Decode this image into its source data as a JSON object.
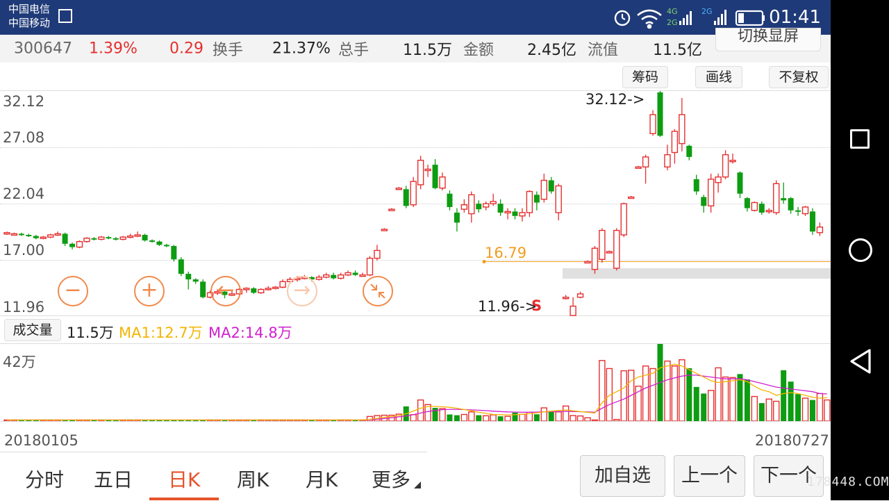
{
  "status_bar": {
    "carrier_1": "中国电信",
    "carrier_2": "中国移动",
    "network_1": "4G",
    "network_2": "2G",
    "network_3": "2G",
    "time": "01:41"
  },
  "quote": {
    "code": "300647",
    "change_pct": "1.39%",
    "change": "0.29",
    "turnover_label": "换手",
    "turnover": "21.37%",
    "total_hands_label": "总手",
    "total_hands": "11.5万",
    "amount_label": "金额",
    "amount": "2.45亿",
    "float_label": "流值",
    "float_value": "11.5亿",
    "switch_button": "切换显屏"
  },
  "toolbar": {
    "chips_label": "筹码",
    "draw_label": "画线",
    "adjust_label": "不复权"
  },
  "chart_data": [
    {
      "type": "candlestick",
      "y_ticks": [
        "32.12",
        "27.08",
        "22.04",
        "17.00",
        "11.96"
      ],
      "ylim": [
        11.96,
        32.12
      ],
      "high_annotation": "32.12->",
      "low_annotation": "11.96->",
      "reference_line": {
        "label": "16.79",
        "value": 16.79
      },
      "low_marker": "S",
      "candles": [
        [
          19.3,
          19.4,
          19.5,
          19.2
        ],
        [
          19.3,
          19.3,
          19.4,
          19.2
        ],
        [
          19.3,
          19.2,
          19.4,
          19.1
        ],
        [
          19.2,
          19.1,
          19.3,
          19.0
        ],
        [
          19.1,
          18.9,
          19.2,
          18.8
        ],
        [
          18.9,
          19.0,
          19.1,
          18.8
        ],
        [
          19.0,
          19.2,
          19.3,
          18.9
        ],
        [
          19.2,
          19.3,
          19.5,
          19.1
        ],
        [
          19.3,
          18.4,
          19.4,
          18.2
        ],
        [
          18.4,
          18.1,
          18.5,
          17.9
        ],
        [
          18.1,
          18.6,
          18.7,
          18.0
        ],
        [
          18.6,
          18.9,
          19.0,
          18.5
        ],
        [
          18.9,
          18.8,
          19.0,
          18.7
        ],
        [
          18.8,
          19.0,
          19.1,
          18.7
        ],
        [
          19.0,
          18.9,
          19.1,
          18.8
        ],
        [
          18.9,
          18.8,
          19.0,
          18.7
        ],
        [
          18.8,
          19.0,
          19.1,
          18.7
        ],
        [
          19.0,
          19.1,
          19.3,
          18.9
        ],
        [
          19.1,
          19.2,
          19.5,
          19.0
        ],
        [
          19.2,
          18.7,
          19.3,
          18.6
        ],
        [
          18.7,
          18.6,
          18.8,
          18.5
        ],
        [
          18.6,
          18.3,
          18.7,
          18.2
        ],
        [
          18.3,
          18.2,
          18.4,
          18.1
        ],
        [
          18.2,
          17.0,
          18.3,
          16.8
        ],
        [
          17.0,
          15.7,
          17.2,
          15.5
        ],
        [
          15.7,
          15.2,
          15.9,
          14.3
        ],
        [
          15.2,
          15.0,
          15.3,
          14.8
        ],
        [
          15.0,
          13.6,
          15.2,
          13.5
        ],
        [
          13.6,
          14.0,
          14.2,
          13.5
        ],
        [
          14.0,
          14.1,
          14.3,
          13.8
        ],
        [
          14.1,
          13.8,
          14.2,
          13.5
        ],
        [
          13.8,
          13.9,
          14.2,
          13.7
        ],
        [
          13.9,
          14.3,
          14.4,
          13.8
        ],
        [
          14.3,
          14.4,
          14.5,
          14.0
        ],
        [
          14.4,
          14.0,
          14.5,
          13.9
        ],
        [
          14.0,
          14.3,
          14.4,
          13.9
        ],
        [
          14.3,
          14.4,
          14.6,
          14.2
        ],
        [
          14.4,
          14.5,
          14.6,
          14.3
        ],
        [
          14.5,
          15.0,
          15.2,
          14.4
        ],
        [
          15.0,
          15.2,
          15.4,
          14.9
        ],
        [
          15.2,
          15.3,
          15.5,
          15.0
        ],
        [
          15.3,
          15.4,
          15.6,
          15.2
        ],
        [
          15.4,
          15.2,
          15.5,
          15.0
        ],
        [
          15.2,
          15.4,
          15.6,
          15.1
        ],
        [
          15.4,
          15.6,
          15.8,
          15.3
        ],
        [
          15.6,
          15.3,
          15.8,
          15.2
        ],
        [
          15.3,
          15.6,
          15.8,
          15.2
        ],
        [
          15.6,
          15.8,
          16.0,
          15.5
        ],
        [
          15.8,
          15.6,
          16.0,
          15.5
        ],
        [
          15.6,
          15.6,
          15.8,
          15.5
        ],
        [
          15.6,
          17.1,
          17.3,
          15.5
        ],
        [
          17.1,
          17.8,
          18.3,
          16.9
        ],
        [
          19.7,
          19.7,
          19.8,
          19.6
        ],
        [
          21.5,
          21.5,
          21.6,
          21.4
        ],
        [
          23.4,
          23.4,
          23.5,
          23.3
        ],
        [
          23.3,
          21.8,
          23.6,
          21.6
        ],
        [
          21.9,
          24.0,
          24.4,
          21.7
        ],
        [
          23.7,
          25.9,
          26.3,
          23.3
        ],
        [
          25.1,
          25.1,
          25.5,
          24.4
        ],
        [
          25.5,
          23.4,
          26.0,
          23.3
        ],
        [
          23.4,
          24.4,
          24.8,
          23.2
        ],
        [
          22.9,
          21.7,
          23.2,
          21.4
        ],
        [
          21.2,
          20.3,
          21.6,
          19.5
        ],
        [
          21.5,
          21.9,
          22.4,
          21.2
        ],
        [
          21.1,
          22.8,
          23.1,
          20.3
        ],
        [
          22.0,
          21.5,
          22.3,
          21.2
        ],
        [
          21.7,
          22.0,
          22.2,
          21.4
        ],
        [
          22.0,
          22.2,
          22.9,
          21.8
        ],
        [
          22.0,
          21.2,
          22.4,
          20.9
        ],
        [
          21.2,
          21.3,
          21.6,
          20.6
        ],
        [
          21.3,
          20.9,
          21.6,
          20.6
        ],
        [
          20.9,
          21.2,
          21.6,
          20.4
        ],
        [
          21.2,
          23.1,
          23.2,
          20.8
        ],
        [
          22.8,
          22.1,
          23.1,
          21.4
        ],
        [
          22.4,
          24.1,
          24.7,
          22.1
        ],
        [
          24.1,
          23.1,
          24.4,
          22.9
        ],
        [
          21.2,
          23.6,
          23.8,
          20.5
        ],
        [
          13.6,
          13.6,
          13.8,
          13.4
        ],
        [
          11.96,
          12.8,
          13.6,
          11.96
        ],
        [
          13.6,
          13.9,
          14.1,
          13.5
        ],
        [
          16.8,
          16.8,
          16.9,
          16.7
        ],
        [
          16.1,
          18.0,
          18.2,
          15.7
        ],
        [
          17.0,
          19.6,
          19.8,
          16.7
        ],
        [
          17.7,
          17.7,
          17.8,
          17.6
        ],
        [
          16.2,
          19.6,
          19.8,
          16.0
        ],
        [
          19.2,
          22.0,
          22.1,
          19.0
        ],
        [
          22.6,
          22.6,
          22.7,
          22.5
        ],
        [
          25.3,
          25.3,
          25.4,
          25.2
        ],
        [
          25.3,
          26.2,
          26.4,
          23.8
        ],
        [
          28.3,
          30.0,
          30.4,
          28.1
        ],
        [
          32.0,
          28.1,
          32.12,
          28.0
        ],
        [
          25.3,
          26.4,
          27.3,
          25.0
        ],
        [
          26.6,
          28.5,
          28.7,
          25.6
        ],
        [
          27.4,
          30.0,
          31.5,
          26.7
        ],
        [
          27.2,
          26.2,
          27.3,
          25.9
        ],
        [
          24.2,
          23.1,
          24.6,
          22.8
        ],
        [
          22.6,
          21.8,
          22.8,
          21.2
        ],
        [
          21.8,
          24.2,
          24.7,
          21.2
        ],
        [
          23.9,
          24.4,
          24.7,
          23.0
        ],
        [
          24.4,
          26.4,
          26.8,
          24.2
        ],
        [
          25.9,
          25.9,
          26.5,
          25.6
        ],
        [
          24.8,
          22.9,
          24.9,
          22.5
        ],
        [
          22.5,
          21.6,
          22.6,
          21.3
        ],
        [
          21.4,
          22.1,
          22.2,
          21.3
        ],
        [
          22.0,
          21.2,
          22.2,
          21.0
        ],
        [
          21.3,
          21.4,
          21.6,
          21.1
        ],
        [
          21.2,
          23.8,
          24.1,
          21.0
        ],
        [
          22.5,
          22.3,
          23.9,
          22.0
        ],
        [
          22.5,
          21.4,
          22.6,
          21.1
        ],
        [
          21.4,
          21.3,
          21.7,
          20.9
        ],
        [
          21.1,
          21.7,
          21.8,
          20.9
        ],
        [
          21.3,
          19.5,
          21.6,
          19.2
        ],
        [
          19.4,
          19.9,
          20.3,
          19.1
        ]
      ]
    },
    {
      "type": "bar",
      "label": "成交量",
      "current": "11.5万",
      "ma1": "MA1:12.7万",
      "ma2": "MA2:14.8万",
      "y_tick": "42万",
      "ylim": [
        0,
        42
      ],
      "x_start": "20180105",
      "x_end": "20180727",
      "values": [
        0.6,
        0.6,
        0.6,
        0.6,
        0.6,
        0.6,
        0.6,
        0.6,
        0.7,
        0.7,
        0.6,
        0.6,
        0.6,
        0.6,
        0.6,
        0.6,
        0.6,
        0.6,
        0.6,
        0.6,
        0.6,
        0.6,
        0.6,
        0.6,
        0.7,
        0.7,
        0.6,
        0.6,
        0.6,
        0.6,
        0.6,
        0.6,
        0.6,
        0.6,
        0.6,
        0.6,
        0.6,
        0.6,
        0.6,
        0.6,
        0.6,
        0.6,
        0.6,
        0.6,
        0.6,
        0.6,
        0.6,
        0.6,
        0.6,
        0.6,
        2.5,
        3.0,
        3.2,
        3.2,
        3.8,
        8.0,
        3.5,
        11.5,
        9.0,
        7.2,
        6.8,
        3.6,
        3.2,
        3.6,
        5.0,
        3.2,
        2.9,
        3.4,
        2.6,
        2.6,
        4.6,
        3.7,
        4.8,
        3.7,
        7.2,
        5.5,
        5.0,
        8.2,
        3.0,
        2.8,
        1.8,
        0.6,
        33.0,
        28.6,
        0.9,
        27.4,
        27.7,
        19.0,
        30.0,
        28.6,
        42.0,
        32.7,
        30.0,
        33.4,
        28.8,
        18.6,
        15.0,
        16.7,
        29.0,
        24.0,
        23.7,
        25.6,
        22.7,
        13.4,
        9.8,
        12.0,
        10.8,
        27.7,
        21.5,
        14.7,
        12.5,
        11.5,
        15.0,
        11.5
      ],
      "ma1_values": [
        0.6,
        0.6,
        0.6,
        0.6,
        0.6,
        0.6,
        0.6,
        0.6,
        0.6,
        0.6,
        0.6,
        0.6,
        0.6,
        0.6,
        0.6,
        0.6,
        0.6,
        0.6,
        0.6,
        0.6,
        0.6,
        0.6,
        0.6,
        0.6,
        0.6,
        0.6,
        0.6,
        0.6,
        0.6,
        0.6,
        0.6,
        0.6,
        0.6,
        0.6,
        0.6,
        0.6,
        0.6,
        0.6,
        0.6,
        0.6,
        0.6,
        0.6,
        0.6,
        0.6,
        0.6,
        0.6,
        0.6,
        0.6,
        0.6,
        0.6,
        1.0,
        1.5,
        2.0,
        2.5,
        3.0,
        4.0,
        5.5,
        7.0,
        8.0,
        8.0,
        7.8,
        7.5,
        7.0,
        6.3,
        5.6,
        4.8,
        4.2,
        3.6,
        3.5,
        3.4,
        3.5,
        3.7,
        4.0,
        4.5,
        5.0,
        5.4,
        5.8,
        6.0,
        5.6,
        5.2,
        4.8,
        4.4,
        10.0,
        14.0,
        16.0,
        18.0,
        22.0,
        24.0,
        25.0,
        26.0,
        29.0,
        30.0,
        31.0,
        30.0,
        28.0,
        26.0,
        24.0,
        22.0,
        21.0,
        21.5,
        22.0,
        22.5,
        21.5,
        19.0,
        17.0,
        16.0,
        14.0,
        15.0,
        15.5,
        15.0,
        14.0,
        13.0,
        12.5,
        12.7
      ],
      "ma2_values": [
        0.6,
        0.6,
        0.6,
        0.6,
        0.6,
        0.6,
        0.6,
        0.6,
        0.6,
        0.6,
        0.6,
        0.6,
        0.6,
        0.6,
        0.6,
        0.6,
        0.6,
        0.6,
        0.6,
        0.6,
        0.6,
        0.6,
        0.6,
        0.6,
        0.6,
        0.6,
        0.6,
        0.6,
        0.6,
        0.6,
        0.6,
        0.6,
        0.6,
        0.6,
        0.6,
        0.6,
        0.6,
        0.6,
        0.6,
        0.6,
        0.6,
        0.6,
        0.6,
        0.6,
        0.6,
        0.6,
        0.6,
        0.6,
        0.6,
        0.6,
        0.8,
        1.0,
        1.4,
        1.8,
        2.3,
        2.8,
        3.5,
        4.4,
        5.2,
        5.8,
        6.2,
        6.4,
        6.4,
        6.3,
        6.1,
        5.9,
        5.7,
        5.4,
        5.2,
        5.0,
        4.9,
        4.8,
        4.8,
        4.9,
        5.0,
        5.1,
        5.2,
        5.3,
        5.2,
        5.1,
        5.0,
        4.8,
        7.0,
        9.0,
        10.5,
        12.0,
        14.0,
        16.0,
        18.0,
        19.5,
        21.0,
        22.5,
        23.5,
        24.5,
        25.0,
        25.0,
        24.5,
        24.0,
        23.5,
        23.0,
        23.0,
        23.0,
        22.5,
        21.5,
        20.5,
        19.5,
        18.5,
        18.0,
        17.5,
        17.0,
        16.5,
        16.0,
        15.0,
        14.8
      ]
    }
  ],
  "tabs": [
    "分时",
    "五日",
    "日K",
    "周K",
    "月K",
    "更多"
  ],
  "actions": {
    "add_watch": "加自选",
    "prev": "上一个",
    "next": "下一个"
  },
  "watermark": "178448.COM",
  "colors": {
    "up": "#e52f2f",
    "down": "#0d9c12",
    "ma1": "#f4b400",
    "ma2": "#d11fcf",
    "accent": "#e5532a",
    "reference": "#f39c1e",
    "status_bar": "#1f3a78"
  }
}
